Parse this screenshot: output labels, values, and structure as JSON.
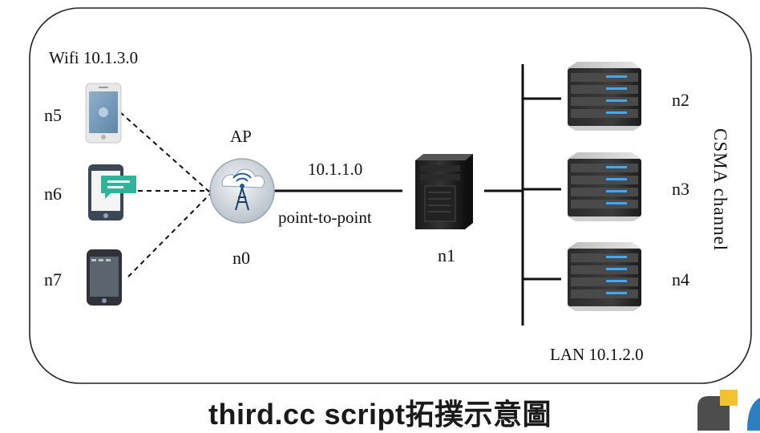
{
  "wifi_label": "Wifi 10.1.3.0",
  "ap_label": "AP",
  "p2p_network": "10.1.1.0",
  "p2p_label": "point-to-point",
  "csma_label": "CSMA channel",
  "lan_label": "LAN 10.1.2.0",
  "caption": "third.cc script拓撲示意圖",
  "nodes": {
    "n0": "n0",
    "n1": "n1",
    "n2": "n2",
    "n3": "n3",
    "n4": "n4",
    "n5": "n5",
    "n6": "n6",
    "n7": "n7"
  },
  "icons": {
    "n5": "phone-icon",
    "n6": "phone-message-icon",
    "n7": "smartphone-icon",
    "n0": "access-point-icon",
    "n1": "desktop-tower-icon",
    "n2": "server-icon",
    "n3": "server-icon",
    "n4": "server-icon"
  }
}
